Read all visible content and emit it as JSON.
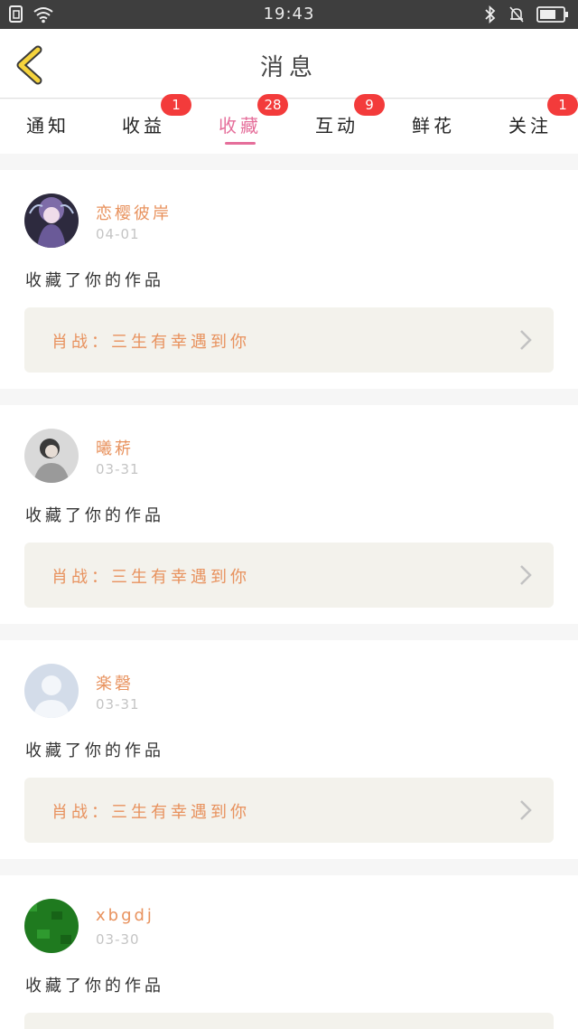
{
  "status_bar": {
    "time": "19:43",
    "icons": [
      "sim-icon",
      "wifi-icon",
      "bluetooth-icon",
      "mute-bell-icon",
      "battery-icon"
    ]
  },
  "header": {
    "title": "消息",
    "back_icon": "chevron-left-icon"
  },
  "colors": {
    "accent_pink": "#e56e9a",
    "name_orange": "#e8925e",
    "badge_red": "#f33b3b",
    "back_yellow": "#f5d33c"
  },
  "tabs": [
    {
      "label": "通知",
      "badge": ""
    },
    {
      "label": "收益",
      "badge": "1"
    },
    {
      "label": "收藏",
      "badge": "28",
      "active": true
    },
    {
      "label": "互动",
      "badge": "9"
    },
    {
      "label": "鲜花",
      "badge": ""
    },
    {
      "label": "关注",
      "badge": "1"
    }
  ],
  "messages": [
    {
      "username": "恋樱彼岸",
      "date": "04-01",
      "action": "收藏了你的作品",
      "work": "肖战：三生有幸遇到你"
    },
    {
      "username": "曦菥",
      "date": "03-31",
      "action": "收藏了你的作品",
      "work": "肖战：三生有幸遇到你"
    },
    {
      "username": "楽磬",
      "date": "03-31",
      "action": "收藏了你的作品",
      "work": "肖战：三生有幸遇到你"
    },
    {
      "username": "xbgdj",
      "date": "03-30",
      "action": "收藏了你的作品",
      "work": ""
    }
  ]
}
